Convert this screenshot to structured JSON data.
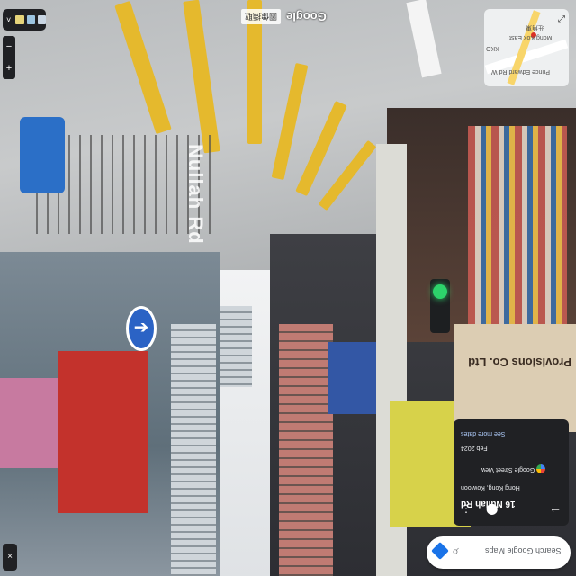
{
  "street_view": {
    "road_name": "Nullah Rd",
    "storefront_sign": "Provisions Co. Ltd"
  },
  "attribution": {
    "chip_label": "圖像擷取",
    "brand": "Google"
  },
  "minimap": {
    "labels": [
      "Mong Kok East",
      "Prince Edward Rd W",
      "旺角東",
      "KKO"
    ]
  },
  "info_card": {
    "title": "16 Nullah Rd",
    "location": "Hong Kong, Kowloon",
    "source": "Google Street View",
    "date": "Feb 2024",
    "more_dates": "See more dates"
  },
  "search": {
    "placeholder": "Search Google Maps"
  },
  "controls": {
    "zoom_in": "+",
    "zoom_out": "−",
    "close": "×",
    "collapse": "˅"
  },
  "colors": {
    "panel_dark": "#202124",
    "link_blue": "#aecbfa",
    "google_blue": "#1a73e8"
  }
}
